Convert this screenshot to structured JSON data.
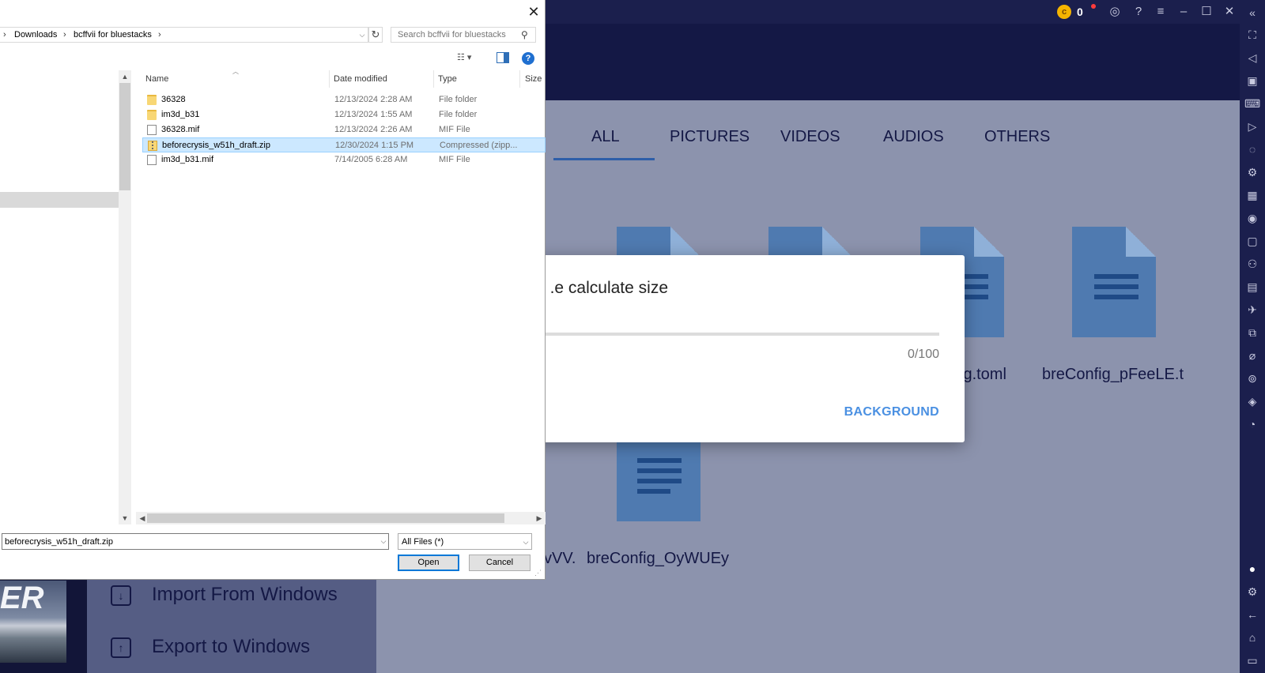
{
  "titlebar": {
    "coins": "0",
    "coin_symbol": "c",
    "icons": [
      "account-icon",
      "help-icon",
      "menu-icon",
      "minimize-icon",
      "maximize-icon",
      "close-icon",
      "collapse-icon"
    ]
  },
  "file_manager": {
    "tabs": [
      {
        "label": "ALL",
        "active": true
      },
      {
        "label": "PICTURES"
      },
      {
        "label": "VIDEOS"
      },
      {
        "label": "AUDIOS"
      },
      {
        "label": "OTHERS"
      }
    ],
    "files": [
      {
        "name": "ig.toml"
      },
      {
        "name": "breConfig_pFeeLE.t"
      },
      {
        "name": "vVV."
      },
      {
        "name": "breConfig_OyWUEy"
      }
    ],
    "sidebar": [
      {
        "label": "Import From Windows"
      },
      {
        "label": "Export to Windows"
      }
    ],
    "thumb_text": "ER"
  },
  "progress_modal": {
    "message": "e calculate size.",
    "progress": 0,
    "count": "0/100",
    "background_button": "BACKGROUND"
  },
  "dialog": {
    "breadcrumb": [
      "Downloads",
      "bcffvii for bluestacks"
    ],
    "search_placeholder": "Search bcffvii for bluestacks",
    "columns": {
      "name": "Name",
      "date": "Date modified",
      "type": "Type",
      "size": "Size"
    },
    "rows": [
      {
        "icon": "folder",
        "name": "36328",
        "date": "12/13/2024 2:28 AM",
        "type": "File folder"
      },
      {
        "icon": "folder",
        "name": "im3d_b31",
        "date": "12/13/2024 1:55 AM",
        "type": "File folder"
      },
      {
        "icon": "file",
        "name": "36328.mif",
        "date": "12/13/2024 2:26 AM",
        "type": "MIF File"
      },
      {
        "icon": "zip",
        "name": "beforecrysis_w51h_draft.zip",
        "date": "12/30/2024 1:15 PM",
        "type": "Compressed (zipp...",
        "selected": true
      },
      {
        "icon": "file",
        "name": "im3d_b31.mif",
        "date": "7/14/2005 6:28 AM",
        "type": "MIF File"
      }
    ],
    "filename_value": "beforecrysis_w51h_draft.zip",
    "filetype": "All Files (*)",
    "open_label": "Open",
    "cancel_label": "Cancel"
  },
  "colors": {
    "accent": "#2e5ea8",
    "modal_button": "#4a90e2",
    "selection": "#cce8ff"
  }
}
